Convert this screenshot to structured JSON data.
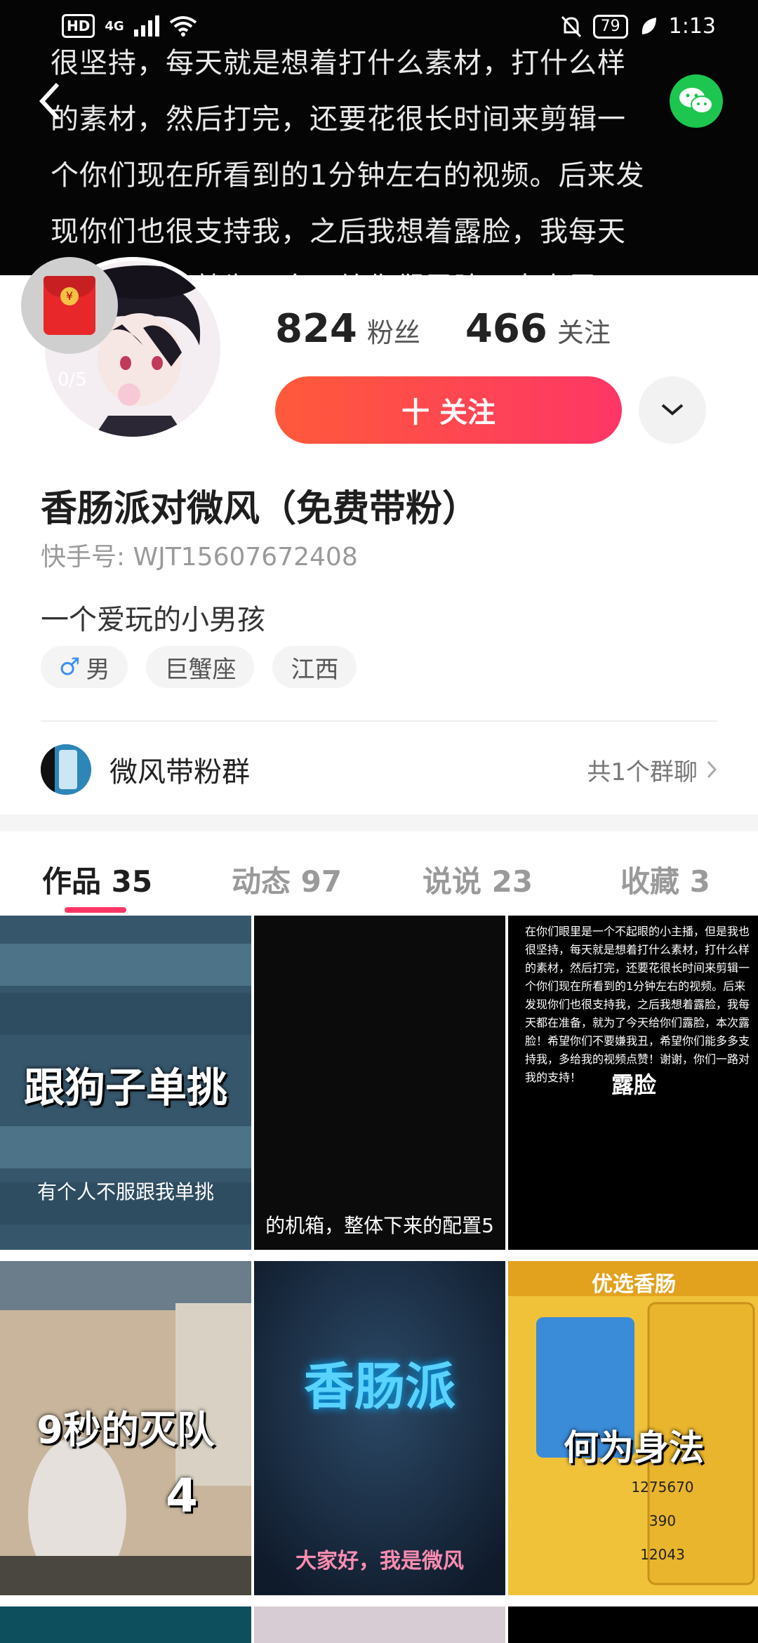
{
  "status_bar": {
    "hd": "HD",
    "network": "4G",
    "battery": "79",
    "time": "1:13"
  },
  "banner": {
    "lines": [
      "很坚持，每天就是想着打什么素材，打什么样",
      "的素材，然后打完，还要花很长时间来剪辑一",
      "个你们现在所看到的1分钟左右的视频。后来发",
      "现你们也很支持我，之后我想着露脸，我每天",
      "都在准备，就为了今天给你们露脸，本次露"
    ]
  },
  "profile": {
    "counter": "0/5",
    "fans_count": "824",
    "fans_label": "粉丝",
    "following_count": "466",
    "following_label": "关注",
    "follow_button": "十 关注",
    "nickname": "香肠派对微风（免费带粉）",
    "kwai_id": "快手号: WJT15607672408",
    "bio": "一个爱玩的小男孩",
    "tags": [
      "男",
      "巨蟹座",
      "江西"
    ]
  },
  "group": {
    "name": "微风带粉群",
    "count": "共1个群聊"
  },
  "tabs": [
    {
      "label": "作品 35",
      "active": true
    },
    {
      "label": "动态 97",
      "active": false
    },
    {
      "label": "说说 23",
      "active": false
    },
    {
      "label": "收藏 3",
      "active": false
    }
  ],
  "videos": [
    {
      "title": "跟狗子单挑",
      "subtitle": "有个人不服跟我单挑"
    },
    {
      "title": "",
      "subtitle": "的机箱，整体下来的配置5"
    },
    {
      "title": "露脸",
      "text": "在你们眼里是一个不起眼的小主播，但是我也很坚持，每天就是想着打什么素材，打什么样的素材，然后打完，还要花很长时间来剪辑一个你们现在所看到的1分钟左右的视频。后来发现你们也很支持我，之后我想着露脸，我每天都在准备，就为了今天给你们露脸，本次露脸！希望你们不要嫌我丑，希望你们能多多支持我，多给我的视频点赞！谢谢，你们一路对我的支持！"
    },
    {
      "title": "9秒的灭队",
      "badge": "4"
    },
    {
      "title": "香肠派",
      "subtitle": "大家好，我是微风"
    },
    {
      "title": "何为身法",
      "header": "优选香肠",
      "stats": [
        "1275670",
        "390",
        "12043"
      ]
    }
  ],
  "colors": {
    "accent": "#fe3666",
    "follow_start": "#ff5a3a",
    "wechat": "#1cc64f"
  }
}
